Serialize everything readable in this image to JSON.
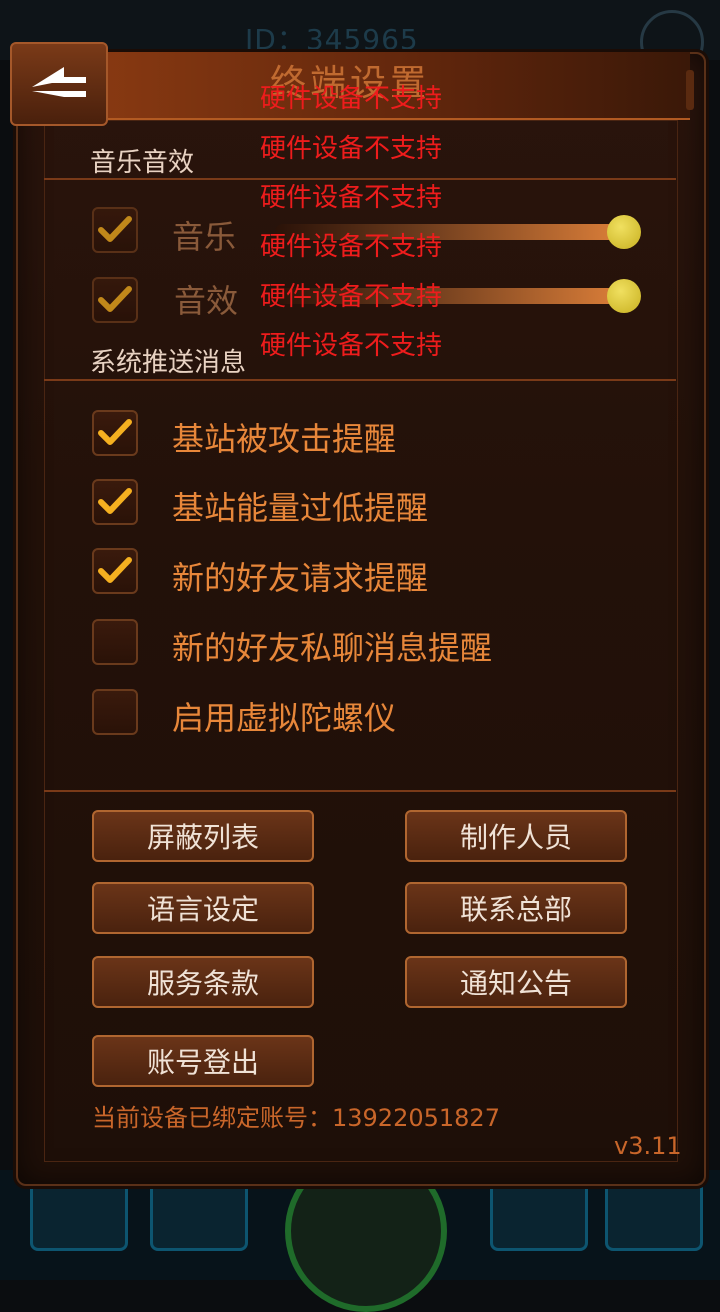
{
  "background": {
    "id_text": "ID：345965"
  },
  "header": {
    "title": "终端设置",
    "back_label": "back"
  },
  "music_section": {
    "title": "音乐音效",
    "music_label": "音乐",
    "sfx_label": "音效",
    "music_level": 1.0,
    "sfx_level": 1.0
  },
  "warnings": [
    "硬件设备不支持",
    "硬件设备不支持",
    "硬件设备不支持",
    "硬件设备不支持",
    "硬件设备不支持",
    "硬件设备不支持"
  ],
  "push_section": {
    "title": "系统推送消息",
    "items": [
      {
        "label": "基站被攻击提醒",
        "checked": true
      },
      {
        "label": "基站能量过低提醒",
        "checked": true
      },
      {
        "label": "新的好友请求提醒",
        "checked": true
      },
      {
        "label": "新的好友私聊消息提醒",
        "checked": false
      },
      {
        "label": "启用虚拟陀螺仪",
        "checked": false
      }
    ]
  },
  "buttons": {
    "block_list": "屏蔽列表",
    "credits": "制作人员",
    "language": "语言设定",
    "contact_hq": "联系总部",
    "terms": "服务条款",
    "notice": "通知公告",
    "logout": "账号登出"
  },
  "footer": {
    "device_account": "当前设备已绑定账号：13922051827",
    "version": "v3.11"
  },
  "colors": {
    "accent": "#e8873a",
    "warning": "#ee1c1c",
    "knob": "#d8c430"
  }
}
